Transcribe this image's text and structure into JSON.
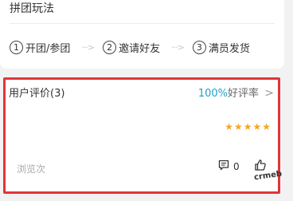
{
  "rules": {
    "title": "拼团玩法",
    "steps": [
      {
        "num": "1",
        "label": "开团/参团"
      },
      {
        "num": "2",
        "label": "邀请好友"
      },
      {
        "num": "3",
        "label": "满员发货"
      }
    ],
    "arrow": "···>"
  },
  "review": {
    "title": "用户评价(3)",
    "rate_value": "100%",
    "rate_label": "好评率",
    "chevron": ">",
    "stars": "★★★★★",
    "views_label": "浏览次",
    "comment_count": "0",
    "watermark": "crmeb"
  },
  "colors": {
    "accent_red": "#e0353b",
    "rate_blue": "#1fa1c9",
    "star_orange": "#f5a623"
  }
}
